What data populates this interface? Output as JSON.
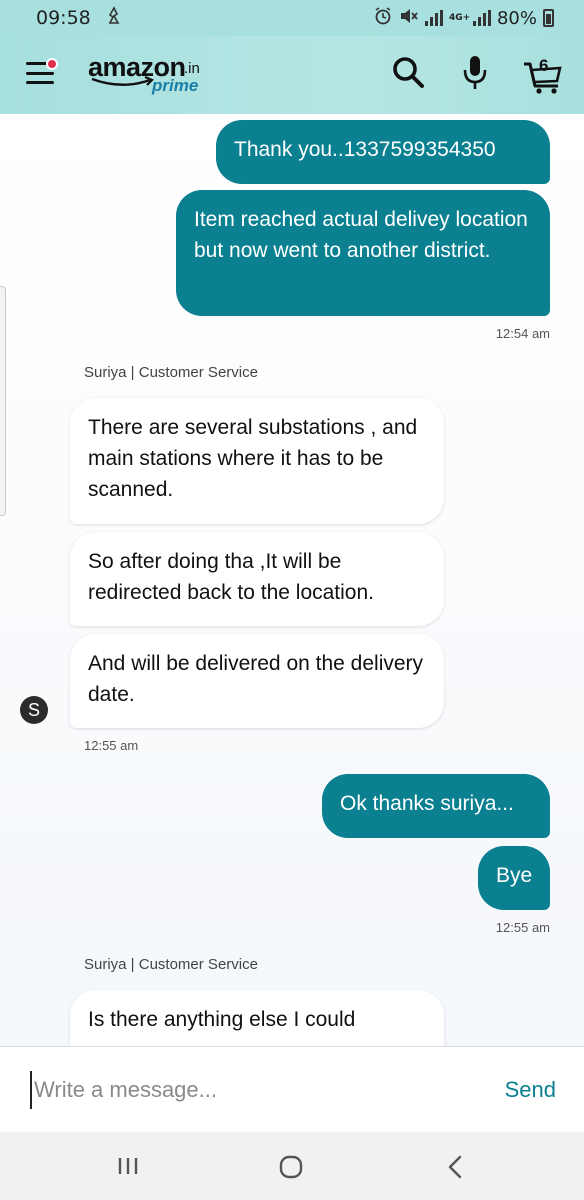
{
  "status_bar": {
    "time": "09:58",
    "network": "4G+",
    "battery": "80%"
  },
  "header": {
    "logo_main": "amazon",
    "logo_suffix": ".in",
    "logo_prime": "prime",
    "cart_count": "6",
    "icons": [
      "hamburger-icon",
      "search-icon",
      "mic-icon",
      "cart-icon"
    ]
  },
  "messages": [
    {
      "type": "out",
      "text": "Thank you..1337599354350"
    },
    {
      "type": "out",
      "text": "Item reached actual delivey location but now went to another district."
    },
    {
      "type": "time",
      "text": "12:54 am"
    },
    {
      "type": "agent_label",
      "text": "Suriya | Customer Service"
    },
    {
      "type": "in",
      "text": "There are several substations , and main stations where it has to be scanned."
    },
    {
      "type": "in",
      "text": "So after doing tha ,It will be redirected back to the location."
    },
    {
      "type": "in",
      "text": "And will be delivered on the delivery date."
    },
    {
      "type": "avatar",
      "text": "S"
    },
    {
      "type": "time",
      "text": "12:55 am"
    },
    {
      "type": "out",
      "text": "Ok thanks suriya..."
    },
    {
      "type": "out",
      "text": "Bye"
    },
    {
      "type": "time",
      "text": "12:55 am"
    },
    {
      "type": "agent_label",
      "text": "Suriya | Customer Service"
    },
    {
      "type": "in",
      "text": "Is there anything else I could"
    }
  ],
  "input": {
    "placeholder": "Write a message...",
    "send_label": "Send"
  },
  "colors": {
    "header_bg": "#a6dfdf",
    "outgoing_bubble": "#0b8090",
    "send_text": "#0b8090",
    "notification_dot": "#e3304f"
  }
}
